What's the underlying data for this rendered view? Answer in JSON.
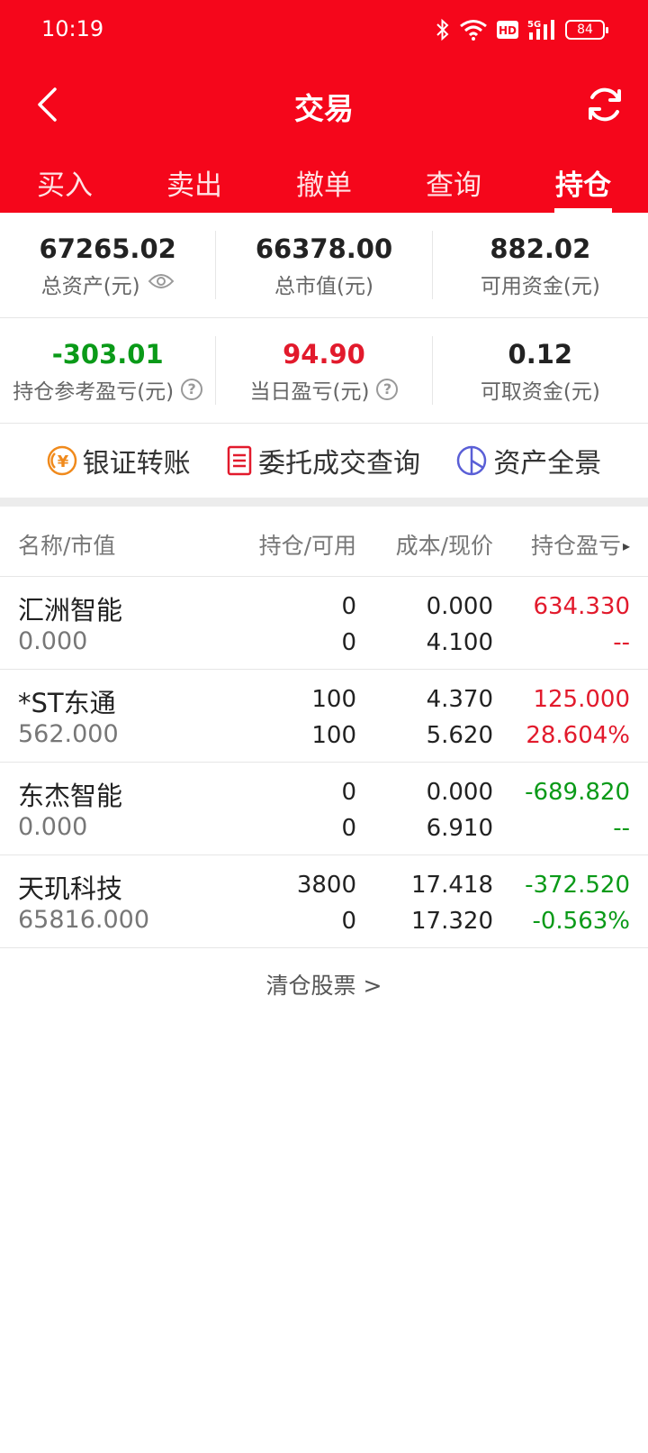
{
  "status": {
    "time": "10:19",
    "battery": "84",
    "hd_label": "HD",
    "network_label": "5G"
  },
  "nav": {
    "title": "交易"
  },
  "tabs": [
    {
      "label": "买入"
    },
    {
      "label": "卖出"
    },
    {
      "label": "撤单"
    },
    {
      "label": "查询"
    },
    {
      "label": "持仓",
      "active": true
    }
  ],
  "summary": {
    "total_assets": {
      "value": "67265.02",
      "label": "总资产(元)"
    },
    "market_value": {
      "value": "66378.00",
      "label": "总市值(元)"
    },
    "available_funds": {
      "value": "882.02",
      "label": "可用资金(元)"
    },
    "position_pl": {
      "value": "-303.01",
      "label": "持仓参考盈亏(元)"
    },
    "daily_pl": {
      "value": "94.90",
      "label": "当日盈亏(元)"
    },
    "withdrawable_funds": {
      "value": "0.12",
      "label": "可取资金(元)"
    },
    "help_glyph": "?"
  },
  "actions": {
    "bank_transfer": {
      "label": "银证转账",
      "glyph": "¥"
    },
    "order_query": {
      "label": "委托成交查询"
    },
    "asset_overview": {
      "label": "资产全景"
    }
  },
  "table": {
    "headers": {
      "name": "名称/市值",
      "holding": "持仓/可用",
      "cost": "成本/现价",
      "pl": "持仓盈亏",
      "more_arrow": "▸"
    },
    "rows": [
      {
        "name": "汇洲智能",
        "market_value": "0.000",
        "holding": "0",
        "available": "0",
        "cost": "0.000",
        "price": "4.100",
        "pl": "634.330",
        "pl_pct": "--",
        "trend": "red"
      },
      {
        "name": "*ST东通",
        "market_value": "562.000",
        "holding": "100",
        "available": "100",
        "cost": "4.370",
        "price": "5.620",
        "pl": "125.000",
        "pl_pct": "28.604%",
        "trend": "red"
      },
      {
        "name": "东杰智能",
        "market_value": "0.000",
        "holding": "0",
        "available": "0",
        "cost": "0.000",
        "price": "6.910",
        "pl": "-689.820",
        "pl_pct": "--",
        "trend": "green"
      },
      {
        "name": "天玑科技",
        "market_value": "65816.000",
        "holding": "3800",
        "available": "0",
        "cost": "17.418",
        "price": "17.320",
        "pl": "-372.520",
        "pl_pct": "-0.563%",
        "trend": "green"
      }
    ]
  },
  "footer": {
    "clear_link": "清仓股票 >"
  },
  "colors": {
    "brand_red": "#f5061b",
    "gain_red": "#e21a2c",
    "loss_green": "#0a9a18"
  }
}
